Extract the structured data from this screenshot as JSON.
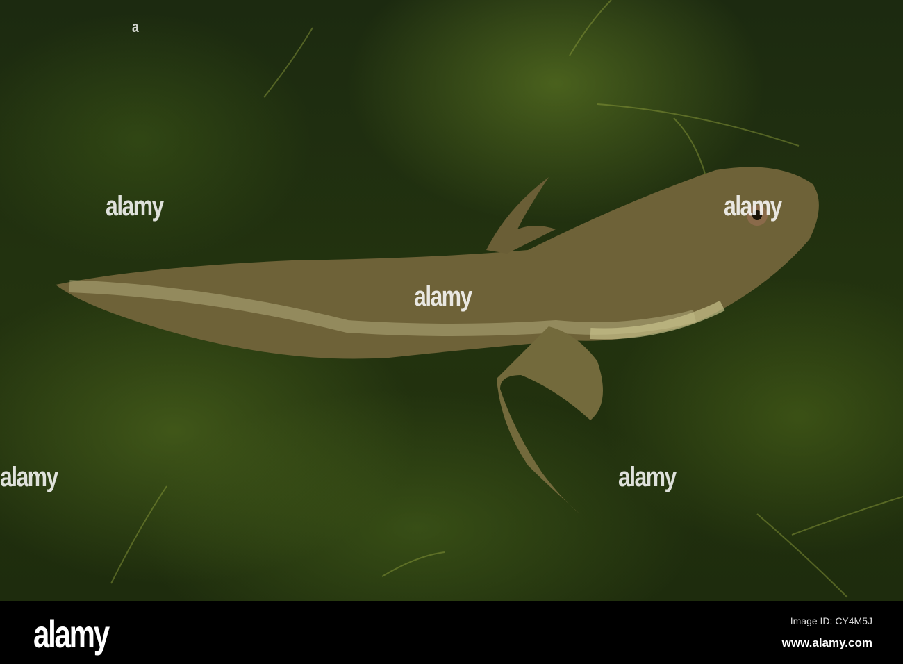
{
  "watermark": {
    "brand": "alamy"
  },
  "footer": {
    "logo": "alamy",
    "image_id": "Image ID: CY4M5J",
    "url": "www.alamy.com"
  },
  "colors": {
    "water": "#23330f",
    "algae": "#6b8a28",
    "tadpole": "#6e6238",
    "belly": "#c8c28c"
  }
}
